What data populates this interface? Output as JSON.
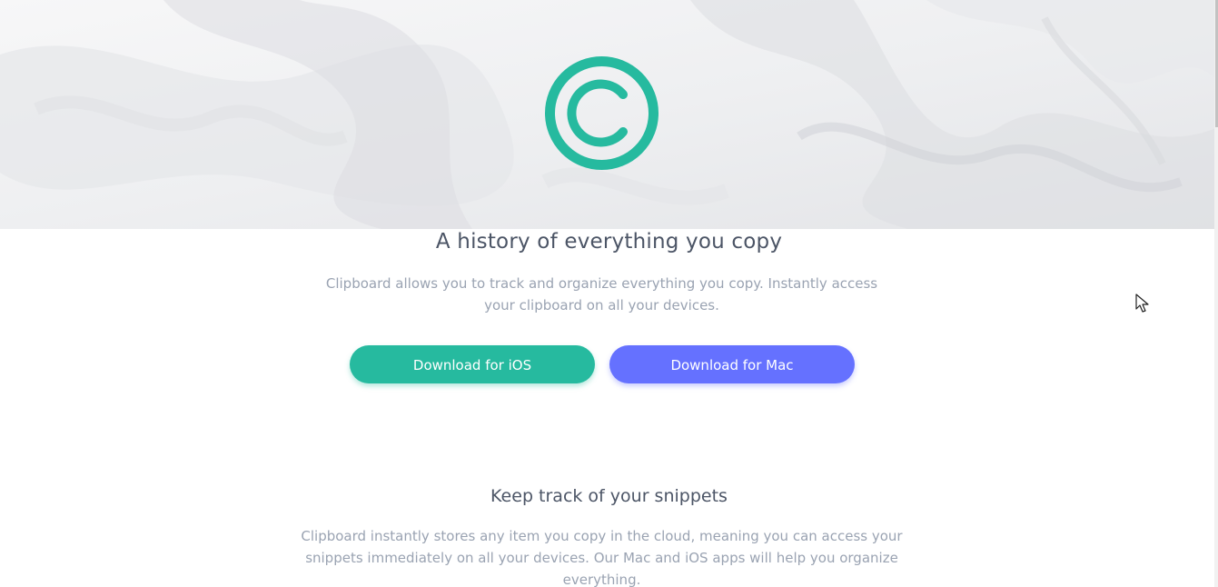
{
  "hero": {
    "logo_icon": "copyright-c-logo-icon",
    "accent_color": "#26ba9f"
  },
  "main": {
    "headline": "A history of everything you copy",
    "intro": "Clipboard allows you to track and organize everything you copy. Instantly access your clipboard on all your devices."
  },
  "buttons": {
    "ios_label": "Download for iOS",
    "ios_color": "#26ba9f",
    "mac_label": "Download for Mac",
    "mac_color": "#6571ff"
  },
  "features": {
    "title": "Keep track of your snippets",
    "text": "Clipboard instantly stores any item you copy in the cloud, meaning you can access your snippets immediately on all your devices. Our Mac and iOS apps will help you organize everything."
  }
}
